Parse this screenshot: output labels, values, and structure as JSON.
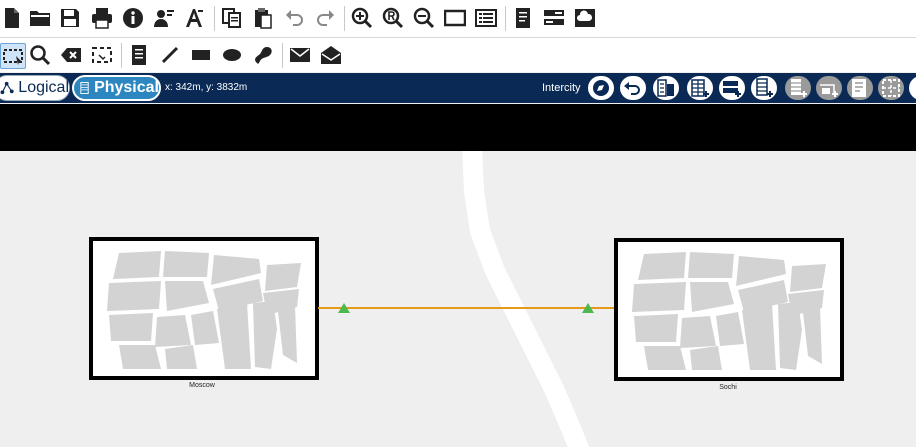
{
  "toolbar_top": {
    "items": [
      {
        "name": "new-file-icon"
      },
      {
        "name": "open-folder-icon"
      },
      {
        "name": "save-icon"
      },
      {
        "name": "print-icon"
      },
      {
        "name": "info-icon"
      },
      {
        "name": "user-edit-icon"
      },
      {
        "name": "text-style-icon"
      },
      {
        "name": "copy-icon"
      },
      {
        "name": "paste-icon"
      },
      {
        "name": "undo-icon"
      },
      {
        "name": "redo-icon"
      },
      {
        "name": "zoom-in-icon"
      },
      {
        "name": "zoom-reset-icon"
      },
      {
        "name": "zoom-out-icon"
      },
      {
        "name": "fit-page-icon"
      },
      {
        "name": "properties-icon"
      },
      {
        "name": "document-icon"
      },
      {
        "name": "rack-icon"
      },
      {
        "name": "cloud-drive-icon"
      }
    ]
  },
  "toolbar_second": {
    "items": [
      {
        "name": "select-icon"
      },
      {
        "name": "search-icon"
      },
      {
        "name": "delete-icon"
      },
      {
        "name": "group-select-icon"
      },
      {
        "name": "note-icon"
      },
      {
        "name": "line-icon"
      },
      {
        "name": "rectangle-icon"
      },
      {
        "name": "ellipse-icon"
      },
      {
        "name": "freeform-icon"
      },
      {
        "name": "mail-icon"
      },
      {
        "name": "mail-open-icon"
      }
    ]
  },
  "navbar": {
    "logical_label": "Logical",
    "physical_label": "Physical",
    "coords": "x: 342m, y: 3832m",
    "view_label": "Intercity"
  },
  "canvas": {
    "sites": [
      {
        "label": "Moscow"
      },
      {
        "label": "Sochi"
      }
    ],
    "colors": {
      "link": "#e59a17",
      "marker": "#4db84d",
      "road": "#ffffff",
      "map_block": "#d3d3d3"
    }
  }
}
